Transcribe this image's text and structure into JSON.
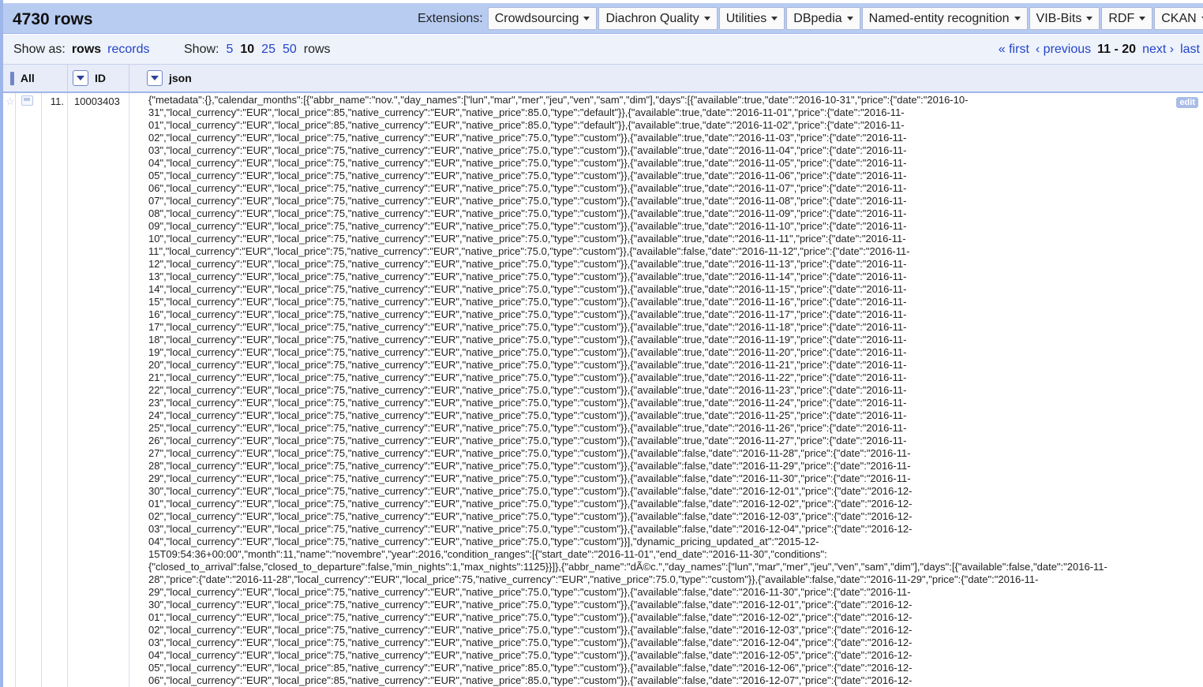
{
  "header": {
    "row_count": "4730 rows",
    "extensions_label": "Extensions:",
    "extensions": [
      {
        "label": "Crowdsourcing"
      },
      {
        "label": "Diachron Quality"
      },
      {
        "label": "Utilities"
      },
      {
        "label": "DBpedia"
      },
      {
        "label": "Named-entity recognition"
      },
      {
        "label": "VIB-Bits"
      },
      {
        "label": "RDF"
      },
      {
        "label": "CKAN"
      }
    ]
  },
  "controls": {
    "show_as_label": "Show as:",
    "mode_rows": "rows",
    "mode_records": "records",
    "show_label": "Show:",
    "page_sizes": [
      "5",
      "10",
      "25",
      "50"
    ],
    "rows_word": "rows",
    "pager": {
      "first": "« first",
      "previous": "‹ previous",
      "range": "11 - 20",
      "next": "next ›",
      "last": "last"
    }
  },
  "columns": {
    "all": "All",
    "id": "ID",
    "json": "json"
  },
  "row": {
    "index": "11.",
    "id": "10003403",
    "edit_label": "edit",
    "json_lines": [
      "{\"metadata\":{},\"calendar_months\":[{\"abbr_name\":\"nov.\",\"day_names\":[\"lun\",\"mar\",\"mer\",\"jeu\",\"ven\",\"sam\",\"dim\"],\"days\":[{\"available\":true,\"date\":\"2016-10-31\",\"price\":{\"date\":\"2016-10-",
      "31\",\"local_currency\":\"EUR\",\"local_price\":85,\"native_currency\":\"EUR\",\"native_price\":85.0,\"type\":\"default\"}},{\"available\":true,\"date\":\"2016-11-01\",\"price\":{\"date\":\"2016-11-",
      "01\",\"local_currency\":\"EUR\",\"local_price\":85,\"native_currency\":\"EUR\",\"native_price\":85.0,\"type\":\"default\"}},{\"available\":true,\"date\":\"2016-11-02\",\"price\":{\"date\":\"2016-11-",
      "02\",\"local_currency\":\"EUR\",\"local_price\":75,\"native_currency\":\"EUR\",\"native_price\":75.0,\"type\":\"custom\"}},{\"available\":true,\"date\":\"2016-11-03\",\"price\":{\"date\":\"2016-11-",
      "03\",\"local_currency\":\"EUR\",\"local_price\":75,\"native_currency\":\"EUR\",\"native_price\":75.0,\"type\":\"custom\"}},{\"available\":true,\"date\":\"2016-11-04\",\"price\":{\"date\":\"2016-11-",
      "04\",\"local_currency\":\"EUR\",\"local_price\":75,\"native_currency\":\"EUR\",\"native_price\":75.0,\"type\":\"custom\"}},{\"available\":true,\"date\":\"2016-11-05\",\"price\":{\"date\":\"2016-11-",
      "05\",\"local_currency\":\"EUR\",\"local_price\":75,\"native_currency\":\"EUR\",\"native_price\":75.0,\"type\":\"custom\"}},{\"available\":true,\"date\":\"2016-11-06\",\"price\":{\"date\":\"2016-11-",
      "06\",\"local_currency\":\"EUR\",\"local_price\":75,\"native_currency\":\"EUR\",\"native_price\":75.0,\"type\":\"custom\"}},{\"available\":true,\"date\":\"2016-11-07\",\"price\":{\"date\":\"2016-11-",
      "07\",\"local_currency\":\"EUR\",\"local_price\":75,\"native_currency\":\"EUR\",\"native_price\":75.0,\"type\":\"custom\"}},{\"available\":true,\"date\":\"2016-11-08\",\"price\":{\"date\":\"2016-11-",
      "08\",\"local_currency\":\"EUR\",\"local_price\":75,\"native_currency\":\"EUR\",\"native_price\":75.0,\"type\":\"custom\"}},{\"available\":true,\"date\":\"2016-11-09\",\"price\":{\"date\":\"2016-11-",
      "09\",\"local_currency\":\"EUR\",\"local_price\":75,\"native_currency\":\"EUR\",\"native_price\":75.0,\"type\":\"custom\"}},{\"available\":true,\"date\":\"2016-11-10\",\"price\":{\"date\":\"2016-11-",
      "10\",\"local_currency\":\"EUR\",\"local_price\":75,\"native_currency\":\"EUR\",\"native_price\":75.0,\"type\":\"custom\"}},{\"available\":true,\"date\":\"2016-11-11\",\"price\":{\"date\":\"2016-11-",
      "11\",\"local_currency\":\"EUR\",\"local_price\":75,\"native_currency\":\"EUR\",\"native_price\":75.0,\"type\":\"custom\"}},{\"available\":false,\"date\":\"2016-11-12\",\"price\":{\"date\":\"2016-11-",
      "12\",\"local_currency\":\"EUR\",\"local_price\":75,\"native_currency\":\"EUR\",\"native_price\":75.0,\"type\":\"custom\"}},{\"available\":true,\"date\":\"2016-11-13\",\"price\":{\"date\":\"2016-11-",
      "13\",\"local_currency\":\"EUR\",\"local_price\":75,\"native_currency\":\"EUR\",\"native_price\":75.0,\"type\":\"custom\"}},{\"available\":true,\"date\":\"2016-11-14\",\"price\":{\"date\":\"2016-11-",
      "14\",\"local_currency\":\"EUR\",\"local_price\":75,\"native_currency\":\"EUR\",\"native_price\":75.0,\"type\":\"custom\"}},{\"available\":true,\"date\":\"2016-11-15\",\"price\":{\"date\":\"2016-11-",
      "15\",\"local_currency\":\"EUR\",\"local_price\":75,\"native_currency\":\"EUR\",\"native_price\":75.0,\"type\":\"custom\"}},{\"available\":true,\"date\":\"2016-11-16\",\"price\":{\"date\":\"2016-11-",
      "16\",\"local_currency\":\"EUR\",\"local_price\":75,\"native_currency\":\"EUR\",\"native_price\":75.0,\"type\":\"custom\"}},{\"available\":true,\"date\":\"2016-11-17\",\"price\":{\"date\":\"2016-11-",
      "17\",\"local_currency\":\"EUR\",\"local_price\":75,\"native_currency\":\"EUR\",\"native_price\":75.0,\"type\":\"custom\"}},{\"available\":true,\"date\":\"2016-11-18\",\"price\":{\"date\":\"2016-11-",
      "18\",\"local_currency\":\"EUR\",\"local_price\":75,\"native_currency\":\"EUR\",\"native_price\":75.0,\"type\":\"custom\"}},{\"available\":true,\"date\":\"2016-11-19\",\"price\":{\"date\":\"2016-11-",
      "19\",\"local_currency\":\"EUR\",\"local_price\":75,\"native_currency\":\"EUR\",\"native_price\":75.0,\"type\":\"custom\"}},{\"available\":true,\"date\":\"2016-11-20\",\"price\":{\"date\":\"2016-11-",
      "20\",\"local_currency\":\"EUR\",\"local_price\":75,\"native_currency\":\"EUR\",\"native_price\":75.0,\"type\":\"custom\"}},{\"available\":true,\"date\":\"2016-11-21\",\"price\":{\"date\":\"2016-11-",
      "21\",\"local_currency\":\"EUR\",\"local_price\":75,\"native_currency\":\"EUR\",\"native_price\":75.0,\"type\":\"custom\"}},{\"available\":true,\"date\":\"2016-11-22\",\"price\":{\"date\":\"2016-11-",
      "22\",\"local_currency\":\"EUR\",\"local_price\":75,\"native_currency\":\"EUR\",\"native_price\":75.0,\"type\":\"custom\"}},{\"available\":true,\"date\":\"2016-11-23\",\"price\":{\"date\":\"2016-11-",
      "23\",\"local_currency\":\"EUR\",\"local_price\":75,\"native_currency\":\"EUR\",\"native_price\":75.0,\"type\":\"custom\"}},{\"available\":true,\"date\":\"2016-11-24\",\"price\":{\"date\":\"2016-11-",
      "24\",\"local_currency\":\"EUR\",\"local_price\":75,\"native_currency\":\"EUR\",\"native_price\":75.0,\"type\":\"custom\"}},{\"available\":true,\"date\":\"2016-11-25\",\"price\":{\"date\":\"2016-11-",
      "25\",\"local_currency\":\"EUR\",\"local_price\":75,\"native_currency\":\"EUR\",\"native_price\":75.0,\"type\":\"custom\"}},{\"available\":true,\"date\":\"2016-11-26\",\"price\":{\"date\":\"2016-11-",
      "26\",\"local_currency\":\"EUR\",\"local_price\":75,\"native_currency\":\"EUR\",\"native_price\":75.0,\"type\":\"custom\"}},{\"available\":true,\"date\":\"2016-11-27\",\"price\":{\"date\":\"2016-11-",
      "27\",\"local_currency\":\"EUR\",\"local_price\":75,\"native_currency\":\"EUR\",\"native_price\":75.0,\"type\":\"custom\"}},{\"available\":false,\"date\":\"2016-11-28\",\"price\":{\"date\":\"2016-11-",
      "28\",\"local_currency\":\"EUR\",\"local_price\":75,\"native_currency\":\"EUR\",\"native_price\":75.0,\"type\":\"custom\"}},{\"available\":false,\"date\":\"2016-11-29\",\"price\":{\"date\":\"2016-11-",
      "29\",\"local_currency\":\"EUR\",\"local_price\":75,\"native_currency\":\"EUR\",\"native_price\":75.0,\"type\":\"custom\"}},{\"available\":false,\"date\":\"2016-11-30\",\"price\":{\"date\":\"2016-11-",
      "30\",\"local_currency\":\"EUR\",\"local_price\":75,\"native_currency\":\"EUR\",\"native_price\":75.0,\"type\":\"custom\"}},{\"available\":false,\"date\":\"2016-12-01\",\"price\":{\"date\":\"2016-12-",
      "01\",\"local_currency\":\"EUR\",\"local_price\":75,\"native_currency\":\"EUR\",\"native_price\":75.0,\"type\":\"custom\"}},{\"available\":false,\"date\":\"2016-12-02\",\"price\":{\"date\":\"2016-12-",
      "02\",\"local_currency\":\"EUR\",\"local_price\":75,\"native_currency\":\"EUR\",\"native_price\":75.0,\"type\":\"custom\"}},{\"available\":false,\"date\":\"2016-12-03\",\"price\":{\"date\":\"2016-12-",
      "03\",\"local_currency\":\"EUR\",\"local_price\":75,\"native_currency\":\"EUR\",\"native_price\":75.0,\"type\":\"custom\"}},{\"available\":false,\"date\":\"2016-12-04\",\"price\":{\"date\":\"2016-12-",
      "04\",\"local_currency\":\"EUR\",\"local_price\":75,\"native_currency\":\"EUR\",\"native_price\":75.0,\"type\":\"custom\"}}],\"dynamic_pricing_updated_at\":\"2015-12-",
      "15T09:54:36+00:00\",\"month\":11,\"name\":\"novembre\",\"year\":2016,\"condition_ranges\":[{\"start_date\":\"2016-11-01\",\"end_date\":\"2016-11-30\",\"conditions\":",
      "{\"closed_to_arrival\":false,\"closed_to_departure\":false,\"min_nights\":1,\"max_nights\":1125}}]},{\"abbr_name\":\"dÃ©c.\",\"day_names\":[\"lun\",\"mar\",\"mer\",\"jeu\",\"ven\",\"sam\",\"dim\"],\"days\":[{\"available\":false,\"date\":\"2016-11-",
      "28\",\"price\":{\"date\":\"2016-11-28\",\"local_currency\":\"EUR\",\"local_price\":75,\"native_currency\":\"EUR\",\"native_price\":75.0,\"type\":\"custom\"}},{\"available\":false,\"date\":\"2016-11-29\",\"price\":{\"date\":\"2016-11-",
      "29\",\"local_currency\":\"EUR\",\"local_price\":75,\"native_currency\":\"EUR\",\"native_price\":75.0,\"type\":\"custom\"}},{\"available\":false,\"date\":\"2016-11-30\",\"price\":{\"date\":\"2016-11-",
      "30\",\"local_currency\":\"EUR\",\"local_price\":75,\"native_currency\":\"EUR\",\"native_price\":75.0,\"type\":\"custom\"}},{\"available\":false,\"date\":\"2016-12-01\",\"price\":{\"date\":\"2016-12-",
      "01\",\"local_currency\":\"EUR\",\"local_price\":75,\"native_currency\":\"EUR\",\"native_price\":75.0,\"type\":\"custom\"}},{\"available\":false,\"date\":\"2016-12-02\",\"price\":{\"date\":\"2016-12-",
      "02\",\"local_currency\":\"EUR\",\"local_price\":75,\"native_currency\":\"EUR\",\"native_price\":75.0,\"type\":\"custom\"}},{\"available\":false,\"date\":\"2016-12-03\",\"price\":{\"date\":\"2016-12-",
      "03\",\"local_currency\":\"EUR\",\"local_price\":75,\"native_currency\":\"EUR\",\"native_price\":75.0,\"type\":\"custom\"}},{\"available\":false,\"date\":\"2016-12-04\",\"price\":{\"date\":\"2016-12-",
      "04\",\"local_currency\":\"EUR\",\"local_price\":75,\"native_currency\":\"EUR\",\"native_price\":75.0,\"type\":\"custom\"}},{\"available\":false,\"date\":\"2016-12-05\",\"price\":{\"date\":\"2016-12-",
      "05\",\"local_currency\":\"EUR\",\"local_price\":85,\"native_currency\":\"EUR\",\"native_price\":85.0,\"type\":\"custom\"}},{\"available\":false,\"date\":\"2016-12-06\",\"price\":{\"date\":\"2016-12-",
      "06\",\"local_currency\":\"EUR\",\"local_price\":85,\"native_currency\":\"EUR\",\"native_price\":85.0,\"type\":\"custom\"}},{\"available\":false,\"date\":\"2016-12-07\",\"price\":{\"date\":\"2016-12-"
    ]
  }
}
